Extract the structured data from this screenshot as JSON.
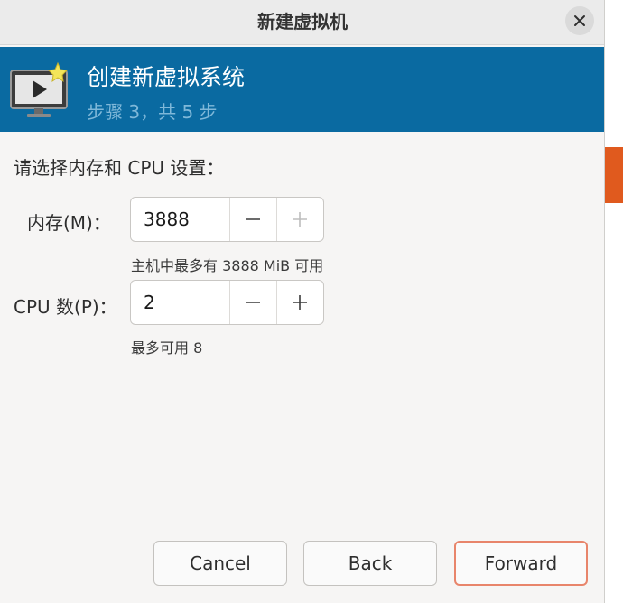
{
  "window": {
    "title": "新建虚拟机"
  },
  "banner": {
    "title": "创建新虚拟系统",
    "step": "步骤 3，共 5 步"
  },
  "instructions": "请选择内存和 CPU 设置：",
  "memory": {
    "label": "内存(M)：",
    "value": "3888",
    "hint": "主机中最多有 3888 MiB 可用"
  },
  "cpus": {
    "label": "CPU 数(P)：",
    "value": "2",
    "hint": "最多可用 8"
  },
  "buttons": {
    "cancel": "Cancel",
    "back": "Back",
    "forward": "Forward"
  },
  "colors": {
    "banner": "#0a6aa1",
    "accent": "#e05a1e",
    "forward_border": "#e8856b"
  },
  "icons": {
    "close": "close-icon",
    "monitor": "vm-monitor-icon",
    "minus": "minus-icon",
    "plus": "plus-icon"
  }
}
